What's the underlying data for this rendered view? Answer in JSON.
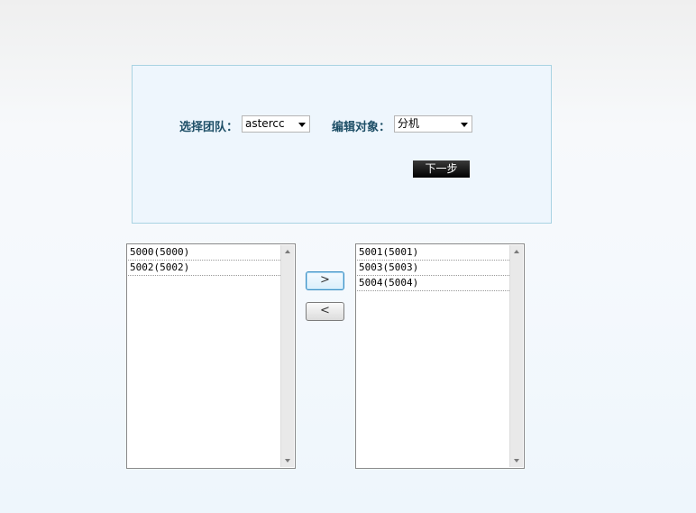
{
  "form": {
    "team_label": "选择团队：",
    "team_value": "astercc",
    "target_label": "编辑对象：",
    "target_value": "分机",
    "next_label": "下一步"
  },
  "left_list": {
    "items": [
      "5000(5000)",
      "5002(5002)"
    ]
  },
  "right_list": {
    "items": [
      "5001(5001)",
      "5003(5003)",
      "5004(5004)"
    ]
  },
  "controls": {
    "move_right_glyph": ">",
    "move_left_glyph": "<"
  }
}
